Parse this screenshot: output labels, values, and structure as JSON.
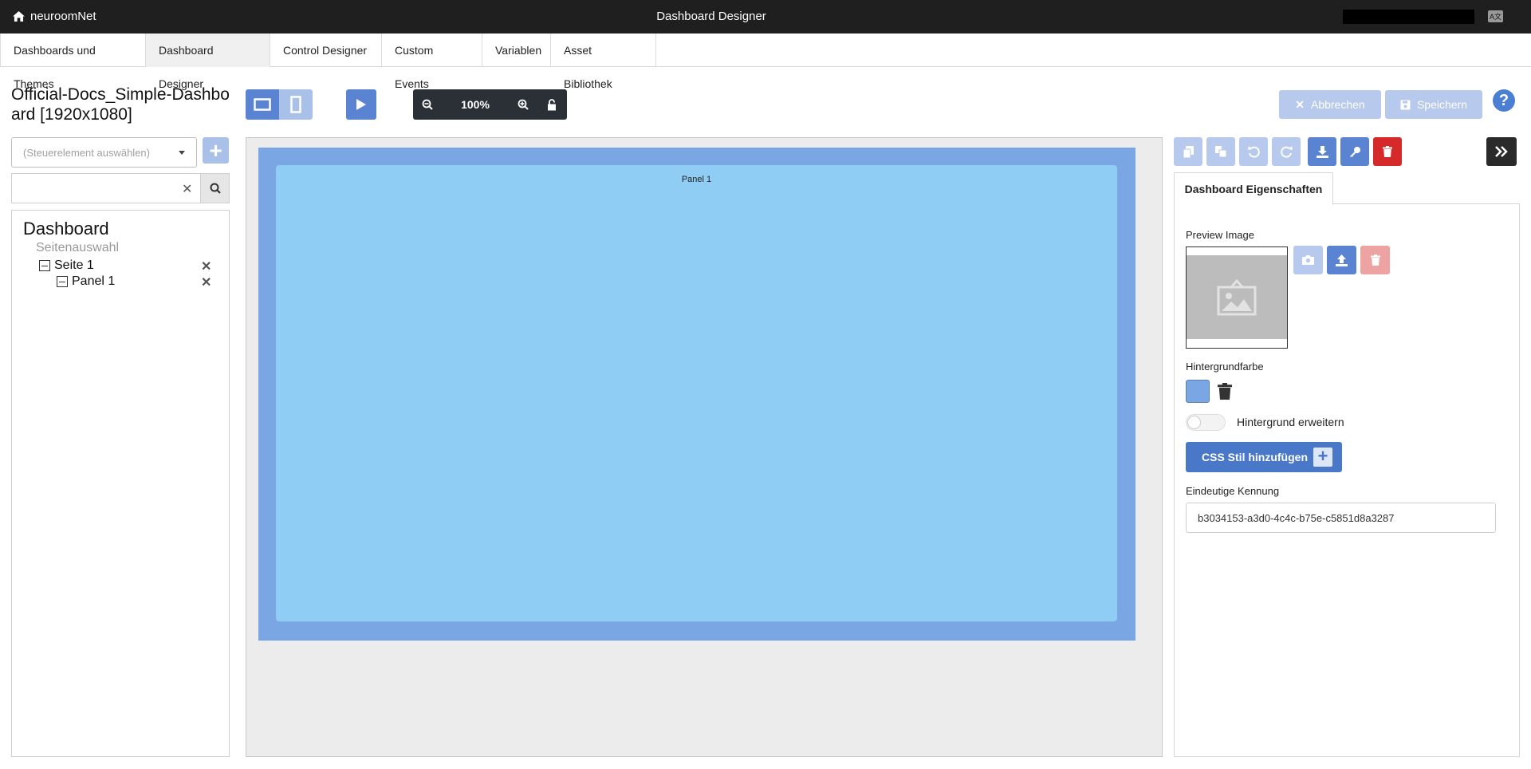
{
  "topbar": {
    "brand": "neuroomNet",
    "title": "Dashboard Designer",
    "lang_badge": "A文"
  },
  "nav": {
    "tabs": [
      {
        "label": "Dashboards und Themes"
      },
      {
        "label": "Dashboard Designer",
        "active": true
      },
      {
        "label": "Control Designer"
      },
      {
        "label": "Custom Events"
      },
      {
        "label": "Variablen"
      },
      {
        "label": "Asset Bibliothek"
      }
    ]
  },
  "header": {
    "dashboard_title": "Official-Docs_Simple-Dashboard [1920x1080]",
    "zoom": "100%",
    "cancel_label": "Abbrechen",
    "save_label": "Speichern",
    "help": "?"
  },
  "left": {
    "select_placeholder": "(Steuerelement auswählen)",
    "search_value": "",
    "tree": {
      "root": "Dashboard",
      "page_select": "Seitenauswahl",
      "page": "Seite 1",
      "panel": "Panel 1"
    }
  },
  "canvas": {
    "panel_title": "Panel 1"
  },
  "right": {
    "tab_label": "Dashboard Eigenschaften",
    "preview_label": "Preview Image",
    "bg_color_label": "Hintergrundfarbe",
    "bg_color": "#7aa7e3",
    "extend_bg_label": "Hintergrund erweitern",
    "css_button_label": "CSS Stil hinzufügen",
    "uid_label": "Eindeutige Kennung",
    "uid_value": "b3034153-a3d0-4c4c-b75e-c5851d8a3287"
  },
  "colors": {
    "accent": "#5a84d2",
    "danger": "#d62a2a",
    "topbar": "#1f1f1f"
  }
}
